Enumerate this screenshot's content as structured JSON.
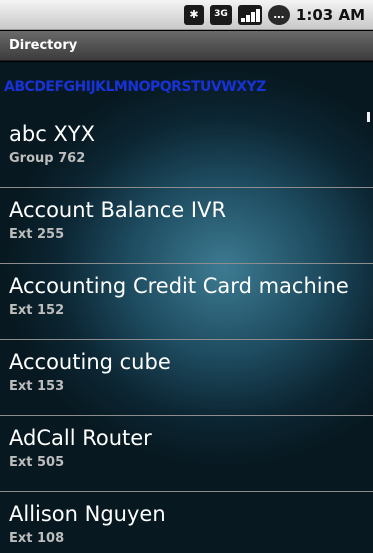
{
  "status_bar": {
    "bluetooth_icon": "bluetooth-icon",
    "network_label": "3G",
    "signal_icon": "signal-strength-icon",
    "talk_icon": "talk-icon",
    "time": "1:03 AM"
  },
  "title_bar": {
    "title": "Directory"
  },
  "alpha_index": {
    "letters": "ABCDEFGHIJKLMNOPQRSTUVWXYZ"
  },
  "contacts": [
    {
      "name": "abc  XYX",
      "detail": "Group 762"
    },
    {
      "name": "Account Balance IVR",
      "detail": "Ext 255"
    },
    {
      "name": "Accounting Credit Card machine",
      "detail": "Ext 152"
    },
    {
      "name": "Accouting cube",
      "detail": "Ext 153"
    },
    {
      "name": "AdCall Router",
      "detail": "Ext 505"
    },
    {
      "name": "Allison Nguyen",
      "detail": "Ext 108"
    }
  ]
}
